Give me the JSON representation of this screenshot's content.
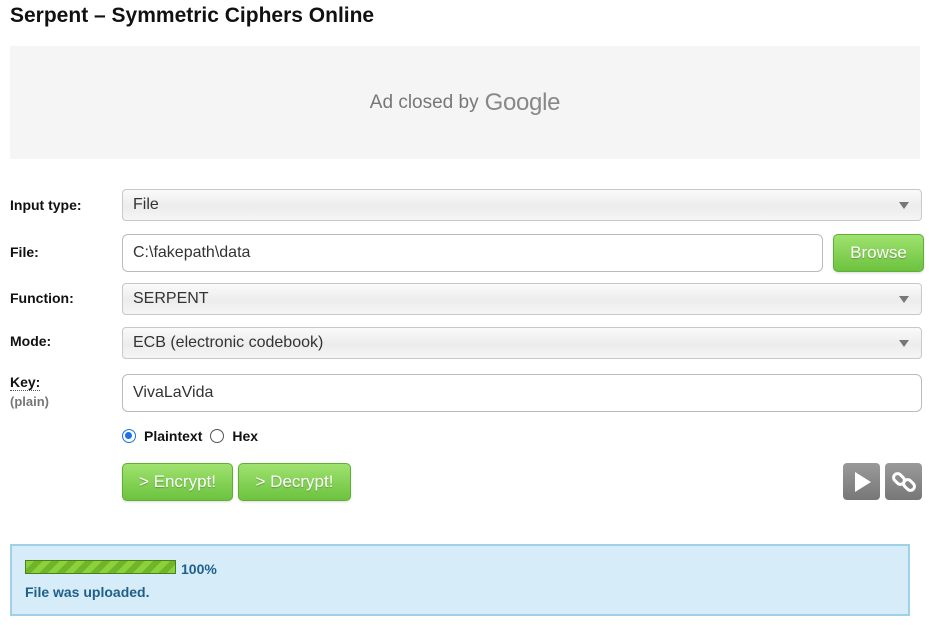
{
  "page": {
    "title": "Serpent – Symmetric Ciphers Online"
  },
  "ad": {
    "text": "Ad closed by",
    "brand": "Google"
  },
  "form": {
    "input_type": {
      "label": "Input type:",
      "value": "File"
    },
    "file": {
      "label": "File:",
      "value": "C:\\fakepath\\data",
      "browse_label": "Browse"
    },
    "function": {
      "label": "Function:",
      "value": "SERPENT"
    },
    "mode": {
      "label": "Mode:",
      "value": "ECB (electronic codebook)"
    },
    "key": {
      "label": "Key:",
      "sublabel": "(plain)",
      "value": "VivaLaVida"
    },
    "key_format": {
      "options": [
        {
          "label": "Plaintext",
          "selected": true
        },
        {
          "label": "Hex",
          "selected": false
        }
      ]
    },
    "encrypt_label": "> Encrypt!",
    "decrypt_label": "> Decrypt!",
    "icons": [
      "play-icon",
      "link-icon"
    ]
  },
  "status": {
    "progress": 100,
    "progress_text": "100%",
    "message": "File was uploaded."
  },
  "colors": {
    "accent_green": "#6cc33e",
    "status_bg": "#d6ecf8",
    "status_text": "#1f5f8b"
  }
}
